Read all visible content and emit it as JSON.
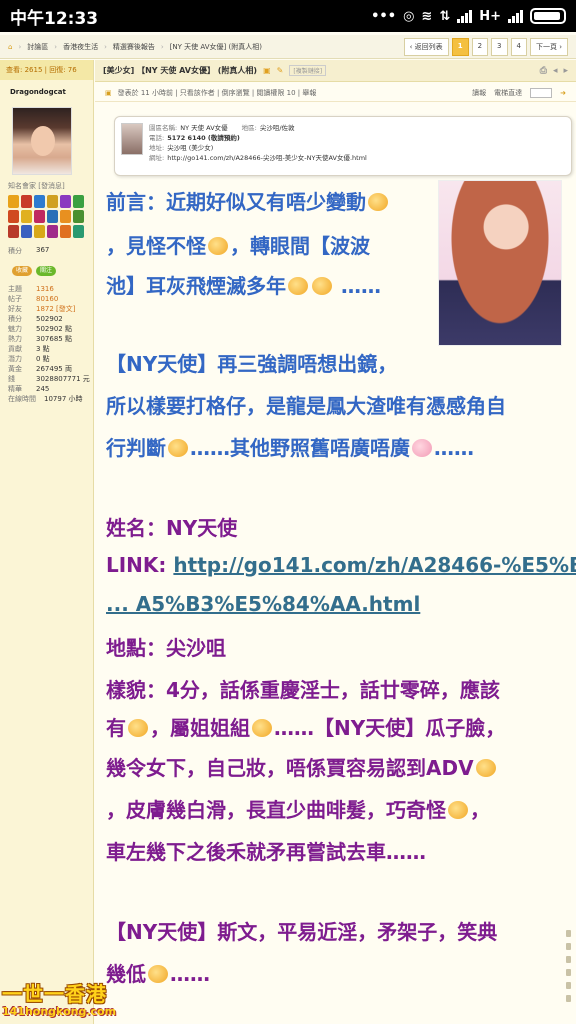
{
  "status_bar": {
    "time": "中午12:33",
    "network": "H+"
  },
  "breadcrumb": {
    "items": [
      "討論區",
      "香港夜生活",
      "精選賽後報告",
      "[NY 天使 AV女優]",
      "(附真人相)"
    ]
  },
  "pagination": {
    "back_label": "‹ 返回列表",
    "pages": [
      "1",
      "2",
      "3",
      "4"
    ],
    "current": "1",
    "next_label": "下一頁 ›"
  },
  "sidebar": {
    "stats_line": "查看: 2615 | 回復: 76",
    "username": "Dragondogcat",
    "profile_label": "知名會家 [發消息]",
    "level_label": "積分",
    "level_value": "367",
    "buttons": [
      "收藏",
      "關注"
    ],
    "fields": [
      {
        "key": "主題",
        "value": "1316"
      },
      {
        "key": "帖子",
        "value": "80160"
      },
      {
        "key": "好友",
        "value": "1872 [發文]"
      },
      {
        "key": "積分",
        "value": "502902"
      },
      {
        "key": "魅力",
        "value": "502902 點"
      },
      {
        "key": "熱力",
        "value": "307685 點"
      },
      {
        "key": "貢獻",
        "value": "3 點"
      },
      {
        "key": "潛力",
        "value": "0 點"
      },
      {
        "key": "黃金",
        "value": "267495 両"
      },
      {
        "key": "錢",
        "value": "3028807771 元"
      },
      {
        "key": "精華",
        "value": "245"
      },
      {
        "key": "在線時間",
        "value": "10797 小時"
      }
    ]
  },
  "thread": {
    "title": "[美少女] 【NY 天使 AV女優】 (附真人相)",
    "tag": "[複製鏈接]",
    "post_meta": "發表於 11 小時前 | 只看該作者 | 倒序瀏覽 | 閱讀權限 10 | 舉報",
    "read_mode": "讀報",
    "goto_label": "電梯直達"
  },
  "info_card": {
    "name_label": "園區名稱:",
    "name": "NY 天使 AV女優",
    "area_label": "地區:",
    "area": "尖沙咀/佐敦",
    "phone_label": "電話:",
    "phone": "5172 6140 (敬請預約)",
    "addr_label": "地址:",
    "addr": "尖沙咀 (美少女)",
    "url_label": "網址:",
    "url": "http://go141.com/zh/A28466-尖沙咀-美少女-NY天使AV女優.html"
  },
  "post": {
    "l1": "前言：近期好似又有唔少變動",
    "l2a": "，見怪不怪",
    "l2b": "，轉眼間【波波",
    "l3a": "池】耳灰飛煙滅多年",
    "l3b": "……",
    "l4": "【NY天使】再三強調唔想出鏡，",
    "l5": "所以樣要打格仔，是龍是鳳大渣唯有憑感角自",
    "l6a": "行判斷",
    "l6b": "……其他野照舊唔廣唔廣",
    "l6c": "……",
    "name_line": "姓名：NY天使",
    "link_label": "LINK: ",
    "link_1": "http://go141.com/zh/A28466-%E5%B",
    "link_2": "... A5%B3%E5%84%AA.html",
    "place": "地點：尖沙咀",
    "looks": "樣貌：4分，話係重慶淫士，話廿零碎，應該",
    "l12a": "有",
    "l12b": "，屬姐姐組",
    "l12c": "……【NY天使】瓜子臉，",
    "l13a": "幾令女下，自己妝，唔係賈容易認到ADV",
    "l14a": "，皮膚幾白滑，長直少曲啡髮，巧奇怪",
    "l14b": "，",
    "l15": "車左幾下之後禾就矛再嘗試去車……",
    "l16": "【NY天使】斯文，平易近淫，矛架子，笑典",
    "l17a": "幾低",
    "l17b": "……"
  },
  "watermark": {
    "big": "一世一香港",
    "small": "141hongkong.com"
  }
}
